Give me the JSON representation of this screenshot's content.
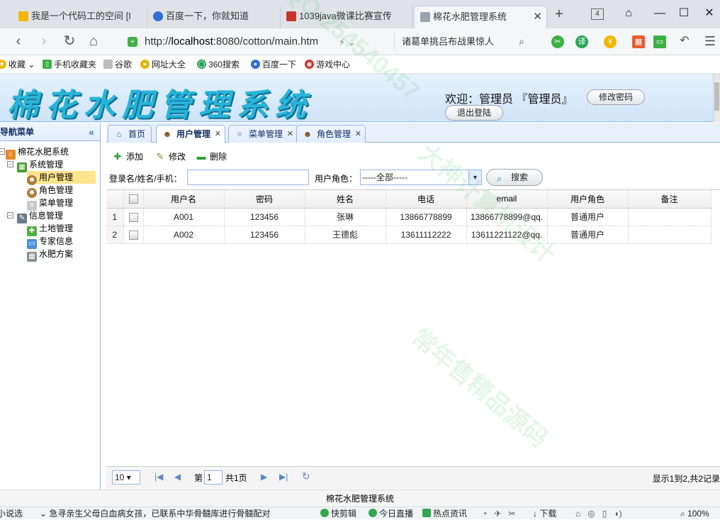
{
  "browser": {
    "tabs": [
      {
        "title": "我是一个代码工的空间 [I",
        "color": "#f2b705"
      },
      {
        "title": "百度一下，你就知道",
        "color": "#2f6fd6"
      },
      {
        "title": "1039java微课比赛宣传",
        "color": "#c7362b"
      },
      {
        "title": "棉花水肥管理系统",
        "color": "#9aa3ad"
      }
    ],
    "tab_count": "4",
    "url_prefix": "http://",
    "url_host": "localhost",
    "url_rest": ":8080/cotton/main.htm",
    "search_text": "诸葛单挑吕布战果惊人",
    "bookmarks": [
      "收藏",
      "手机收藏夹",
      "谷歌",
      "网址大全",
      "360搜索",
      "百度一下",
      "游戏中心"
    ]
  },
  "header": {
    "title": "棉花水肥管理系统",
    "welcome": "欢迎：管理员 『管理员』",
    "change_password": "修改密码",
    "logout": "退出登陆"
  },
  "sidebar": {
    "title": "导航菜单",
    "root": "棉花水肥系统",
    "groups": [
      {
        "label": "系统管理",
        "items": [
          "用户管理",
          "角色管理",
          "菜单管理"
        ]
      },
      {
        "label": "信息管理",
        "items": [
          "土地管理",
          "专家信息",
          "水肥方案"
        ]
      }
    ]
  },
  "content_tabs": [
    "首页",
    "用户管理",
    "菜单管理",
    "角色管理"
  ],
  "toolbar": {
    "add": "添加",
    "edit": "修改",
    "delete": "删除"
  },
  "filters": {
    "keyword_label": "登录名/姓名/手机：",
    "keyword_value": "",
    "role_label": "用户角色：",
    "role_selected": "-----全部-----",
    "search": "搜索"
  },
  "grid": {
    "columns": [
      "用户名",
      "密码",
      "姓名",
      "电话",
      "email",
      "用户角色",
      "备注"
    ],
    "rows": [
      {
        "no": "1",
        "cells": [
          "A001",
          "123456",
          "张琳",
          "13866778899",
          "13866778899@qq.",
          "普通用户",
          ""
        ]
      },
      {
        "no": "2",
        "cells": [
          "A002",
          "123456",
          "王德彪",
          "13611112222",
          "13611221122@qq.",
          "普通用户",
          ""
        ]
      }
    ]
  },
  "pager": {
    "page_size": "10",
    "page_prefix": "第",
    "page": "1",
    "page_total": "共1页",
    "info": "显示1到2,共2记录"
  },
  "footer": "棉花水肥管理系统",
  "statusbar": {
    "left": "小说选",
    "news": "急寻亲生父母白血病女孩，已联系中华骨髓库进行骨髓配对",
    "items": [
      "快剪辑",
      "今日直播",
      "热点资讯"
    ],
    "download": "下载",
    "zoom": "100%"
  },
  "watermarks": [
    "QQ:254540457",
    "大神计算机设计",
    "常年售精品源码"
  ]
}
